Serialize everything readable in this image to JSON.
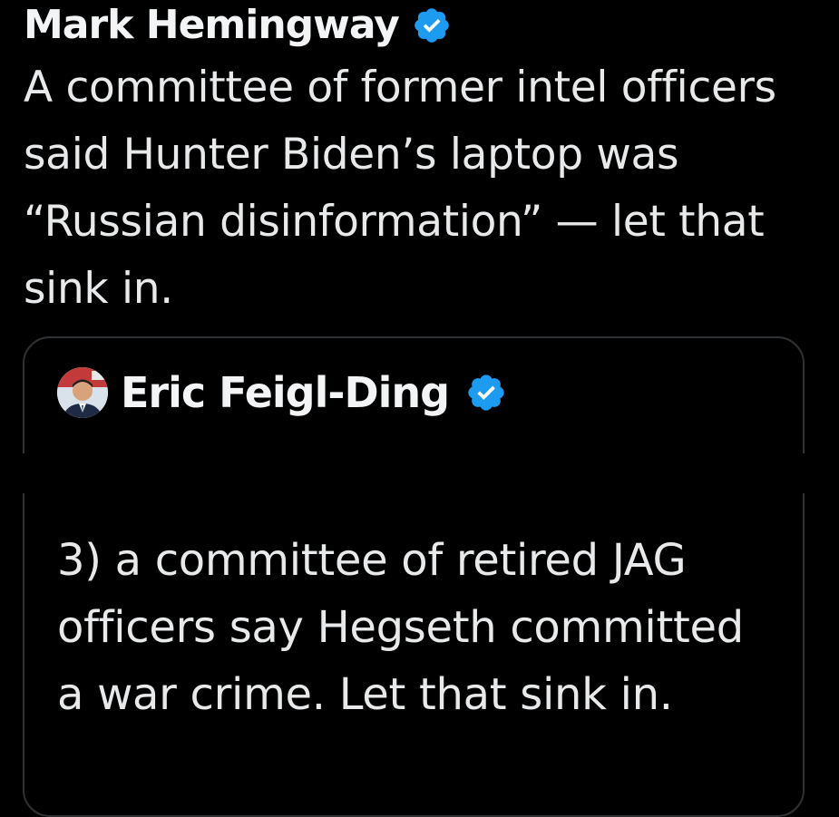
{
  "tweet": {
    "author_name": "Mark Hemingway",
    "verified_icon": "verified-badge-icon",
    "text": "A committee of former intel officers said Hunter Biden’s laptop was “Russian disinformation” — let that sink in."
  },
  "quote": {
    "author_name": "Eric Feigl-Ding",
    "verified_icon": "verified-badge-icon",
    "avatar_icon": "avatar-photo",
    "text": "3) a committee of retired JAG officers say Hegseth committed a war crime. Let that sink in."
  },
  "colors": {
    "background": "#000000",
    "text": "#e7e9ea",
    "verified_blue": "#1d9bf0",
    "card_border": "#2f3336"
  }
}
